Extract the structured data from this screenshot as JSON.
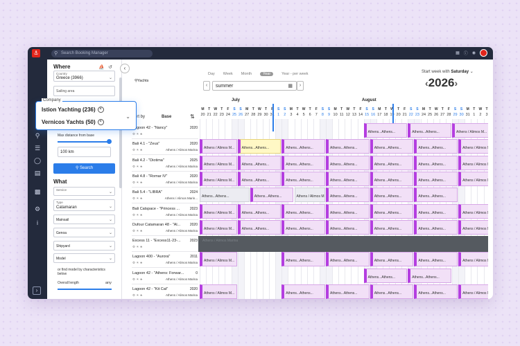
{
  "app": {
    "search_placeholder": "Search Booking Manager",
    "logo": "⚓"
  },
  "sidebar": {
    "where_title": "Where",
    "country_label": "Country",
    "country_value": "Greece (3966)",
    "sailing_area_label": "Sailing area",
    "max_distance_label": "Max distance from base",
    "distance_value": "100 km",
    "search_button": "Search",
    "what_title": "What",
    "service_label": "Service",
    "type_label": "Type",
    "type_value": "Catamaran",
    "mainsail_label": "Mainsail",
    "genoa_label": "Genoa",
    "shipyard_label": "Shipyard",
    "model_label": "Model",
    "find_model_text": "or find model by characteristics below",
    "overall_length_label": "Overall length",
    "any_label": "any"
  },
  "company_popup": {
    "label": "Company",
    "chips": [
      "Istion Yachting (236)",
      "Vernicos Yachts (50)"
    ]
  },
  "calendar": {
    "yachts_tab": "Yachts",
    "sort_by": "Sort by",
    "base_col": "Base",
    "view_modes": [
      "Day",
      "Week",
      "Month",
      "Year",
      "Year - per week"
    ],
    "active_mode": "Year",
    "season_value": "summer",
    "start_week_label": "Start week with",
    "start_week_value": "Saturday",
    "year": "2026",
    "months": [
      "July",
      "August"
    ],
    "day_names": [
      "M",
      "T",
      "W",
      "T",
      "F",
      "S",
      "S",
      "M",
      "T",
      "W",
      "T",
      "F",
      "S",
      "S",
      "M",
      "T",
      "W",
      "T",
      "F",
      "S",
      "S",
      "M",
      "T",
      "W",
      "T",
      "F",
      "S",
      "S",
      "M",
      "T",
      "W",
      "T",
      "F",
      "S",
      "S",
      "M",
      "T",
      "W",
      "T",
      "F",
      "S",
      "S",
      "M",
      "T",
      "W",
      "T"
    ],
    "day_numbers": [
      "20",
      "21",
      "22",
      "23",
      "24",
      "25",
      "26",
      "27",
      "28",
      "29",
      "30",
      "31",
      "1",
      "2",
      "3",
      "4",
      "5",
      "6",
      "7",
      "8",
      "9",
      "10",
      "11",
      "12",
      "13",
      "14",
      "15",
      "16",
      "17",
      "18",
      "19",
      "20",
      "21",
      "22",
      "23",
      "24",
      "25",
      "26",
      "27",
      "28",
      "29",
      "30",
      "31",
      "1",
      "2",
      "3"
    ]
  },
  "yachts": [
    {
      "name": "Lagoon 42 - \"Nancy\"",
      "year": "2020",
      "base": ""
    },
    {
      "name": "Bali 4.1 - \"Zeus\"",
      "year": "2020",
      "base": "Athens / Alimos Marina"
    },
    {
      "name": "Bali 4.2 - \"Diotima\"",
      "year": "2025",
      "base": "Athens / Alimos Marina"
    },
    {
      "name": "Bali 4.8 - \"Romar IV\"",
      "year": "2020",
      "base": "Athens / Alimos Marina"
    },
    {
      "name": "Bali 5.4 - \"LIBRA\"",
      "year": "2024",
      "base": "Athens / Alimos Marin..."
    },
    {
      "name": "Bali Catspace - \"Princess ...",
      "year": "2023",
      "base": "Athens / Alimos Marina"
    },
    {
      "name": "Dufour Catamaran 48 - \"Al...",
      "year": "2020",
      "base": "Athens / Alimos Marina"
    },
    {
      "name": "Excess 11 - \"Excess11-23-...",
      "year": "2023",
      "base": ""
    },
    {
      "name": "Lagoon 400 - \"Aurora\"",
      "year": "2011",
      "base": "Athens / Alimos Marina"
    },
    {
      "name": "Lagoon 42 - \"Athens: Forwar...",
      "year": "0",
      "base": "Athens / Alimos Marina"
    },
    {
      "name": "Lagoon 42 - \"Kit Cat\"",
      "year": "2020",
      "base": "Athens / Alimos Marina"
    }
  ],
  "booking_label": "Athens...Athens...",
  "booking_label_short": "Athens / Alimos M...",
  "dark_row_label": "Athens / Alimos Marina",
  "colors": {
    "brand": "#e1251b",
    "accent": "#2b7de9",
    "booking": "#b43ee0"
  }
}
